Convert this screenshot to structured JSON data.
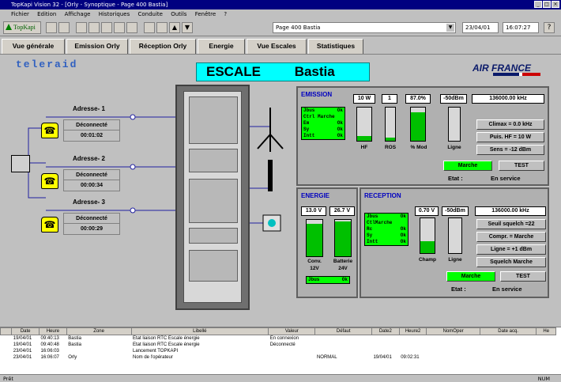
{
  "window": {
    "title": "TopKapi Vision 32 - [Orly - Synoptique - Page 400 Bastia]",
    "menu": [
      "Fichier",
      "Edition",
      "Affichage",
      "Historiques",
      "Conduite",
      "Outils",
      "Fenêtre",
      "?"
    ]
  },
  "toolbar": {
    "logo": "TopKapi",
    "page_field": "Page 400 Bastia",
    "date": "23/04/01",
    "time": "16:07:27",
    "icons": [
      "save-icon",
      "tools-icon",
      "print-icon",
      "chart-icon",
      "alarm-icon",
      "pen-icon",
      "window-icon",
      "graph-icon",
      "grid-icon",
      "up-arrow-icon",
      "down-arrow-icon",
      "help-icon"
    ]
  },
  "tabs": [
    {
      "label": "Vue générale"
    },
    {
      "label": "Emission Orly"
    },
    {
      "label": "Réception Orly"
    },
    {
      "label": "Energie"
    },
    {
      "label": "Vue Escales"
    },
    {
      "label": "Statistiques"
    }
  ],
  "brand": {
    "left": "teleraid",
    "airline": "AIR FRANCE"
  },
  "station": {
    "label": "ESCALE",
    "name": "Bastia"
  },
  "lines": [
    {
      "label": "Adresse- 1",
      "status": "Déconnecté",
      "time": "00:01:02"
    },
    {
      "label": "Adresse- 2",
      "status": "Déconnecté",
      "time": "00:00:34"
    },
    {
      "label": "Adresse- 3",
      "status": "Déconnecté",
      "time": "00:00:29"
    }
  ],
  "emission": {
    "title": "EMISSION",
    "lcd": [
      [
        "Jbus",
        "Ok"
      ],
      [
        "Ctrl Marche",
        ""
      ],
      [
        "Em",
        "Ok"
      ],
      [
        "Sy",
        "Ok"
      ],
      [
        "Intt",
        "Ok"
      ]
    ],
    "values": [
      "10 W",
      "1",
      "87.0%",
      "-50dBm"
    ],
    "frequency": "136000.00 kHz",
    "bars": [
      {
        "label": "HF",
        "level": 0.15
      },
      {
        "label": "ROS",
        "level": 0.1
      },
      {
        "label": "% Mod",
        "level": 0.85
      },
      {
        "label": "Ligne",
        "level": 0.0
      }
    ],
    "info": [
      "Climax = 0.0 kHz",
      "Puis. HF = 10 W",
      "Sens = -12 dBm"
    ],
    "marche": "Marche",
    "test": "TEST",
    "etat_label": "Etat :",
    "etat_value": "En service"
  },
  "energie": {
    "title": "ENERGIE",
    "values": [
      "13.0 V",
      "26.7 V"
    ],
    "bars": [
      {
        "label1": "Conv.",
        "label2": "12V",
        "level": 0.9
      },
      {
        "label1": "Batterie",
        "label2": "24V",
        "level": 0.95
      }
    ],
    "lcd": [
      [
        "Jbus",
        "Ok"
      ]
    ]
  },
  "reception": {
    "title": "RECEPTION",
    "lcd": [
      [
        "Jbus",
        "Ok"
      ],
      [
        "CtlMarche",
        ""
      ],
      [
        "Rc",
        "Ok"
      ],
      [
        "Sy",
        "Ok"
      ],
      [
        "Intt",
        "Ok"
      ]
    ],
    "values": [
      "0.70 V",
      "-50dBm"
    ],
    "frequency": "136000.00 kHz",
    "bars": [
      {
        "label": "Champ",
        "level": 0.35
      },
      {
        "label": "Ligne",
        "level": 0.0
      }
    ],
    "info": [
      "Seuil squelch =22",
      "Compr. = Marche",
      "Ligne = +1 dBm",
      "Squelch Marche"
    ],
    "marche": "Marche",
    "test": "TEST",
    "etat_label": "Etat :",
    "etat_value": "En service"
  },
  "log": {
    "headers": [
      "",
      "Date",
      "Heure",
      "Zone",
      "Libellé",
      "Valeur",
      "Défaut",
      "Date2",
      "Heure2",
      "NomOper",
      "Date acq.",
      "He"
    ],
    "rows": [
      [
        "",
        "19/04/01",
        "09:40:13",
        "Bastia",
        "Etat liaison RTC Escale énergie",
        "En connexion",
        "",
        "",
        "",
        "",
        "",
        ""
      ],
      [
        "",
        "19/04/01",
        "09:40:48",
        "Bastia",
        "Etat liaison RTC Escale énergie",
        "Déconnecté",
        "",
        "",
        "",
        "",
        "",
        ""
      ],
      [
        "",
        "23/04/01",
        "16:06:03",
        "",
        "Lancement TOPKAPI",
        "",
        "",
        "",
        "",
        "",
        "",
        ""
      ],
      [
        "",
        "23/04/01",
        "16:06:07",
        "Orly",
        "Nom de l'opérateur",
        "",
        "NORMAL",
        "19/04/01",
        "09:02:31",
        "",
        "",
        ""
      ]
    ]
  },
  "status": {
    "left": "Prêt",
    "right": "NUM"
  }
}
